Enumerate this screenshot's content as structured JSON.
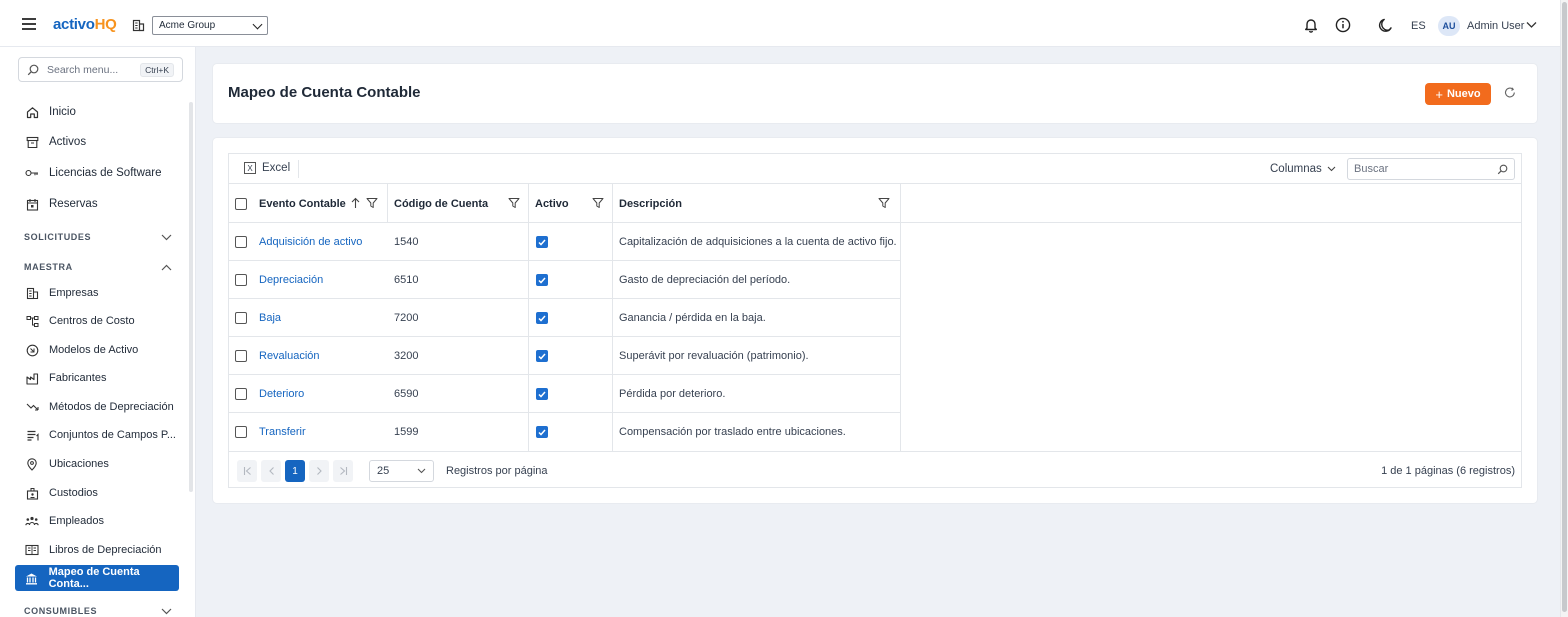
{
  "app": {
    "logo_part1": "activo",
    "logo_part2": "HQ",
    "organization": "Acme Group",
    "language": "ES",
    "user_initials": "AU",
    "user_name": "Admin User",
    "accent_color": "#1565c0",
    "brand_orange": "#f26b1d"
  },
  "sidebar": {
    "search_placeholder": "Search menu...",
    "search_shortcut": "Ctrl+K",
    "items": [
      {
        "label": "Inicio",
        "icon": "home-icon"
      },
      {
        "label": "Activos",
        "icon": "archive-icon"
      },
      {
        "label": "Licencias de Software",
        "icon": "key-icon"
      },
      {
        "label": "Reservas",
        "icon": "calendar-icon"
      }
    ],
    "sections": [
      {
        "label": "SOLICITUDES",
        "expanded": false
      },
      {
        "label": "MAESTRA",
        "expanded": true
      },
      {
        "label": "CONSUMIBLES",
        "expanded": false
      }
    ],
    "maestra_items": [
      {
        "label": "Empresas",
        "icon": "building-icon"
      },
      {
        "label": "Centros de Costo",
        "icon": "org-chart-icon"
      },
      {
        "label": "Modelos de Activo",
        "icon": "model-icon"
      },
      {
        "label": "Fabricantes",
        "icon": "factory-icon"
      },
      {
        "label": "Métodos de Depreciación",
        "icon": "trending-down-icon"
      },
      {
        "label": "Conjuntos de Campos P...",
        "icon": "fields-icon"
      },
      {
        "label": "Ubicaciones",
        "icon": "map-pin-icon"
      },
      {
        "label": "Custodios",
        "icon": "badge-icon"
      },
      {
        "label": "Empleados",
        "icon": "users-icon"
      },
      {
        "label": "Libros de Depreciación",
        "icon": "book-icon"
      },
      {
        "label": "Mapeo de Cuenta Conta...",
        "icon": "bank-icon",
        "active": true
      }
    ]
  },
  "header": {
    "title": "Mapeo de Cuenta Contable",
    "new_button": "Nuevo"
  },
  "table": {
    "excel_label": "Excel",
    "columns_label": "Columnas",
    "search_placeholder": "Buscar",
    "headers": [
      "Evento Contable",
      "Código de Cuenta",
      "Activo",
      "Descripción"
    ],
    "rows": [
      {
        "event": "Adquisición de activo",
        "code": "1540",
        "active": true,
        "description": "Capitalización de adquisiciones a la cuenta de activo fijo."
      },
      {
        "event": "Depreciación",
        "code": "6510",
        "active": true,
        "description": "Gasto de depreciación del período."
      },
      {
        "event": "Baja",
        "code": "7200",
        "active": true,
        "description": "Ganancia / pérdida en la baja."
      },
      {
        "event": "Revaluación",
        "code": "3200",
        "active": true,
        "description": "Superávit por revaluación (patrimonio)."
      },
      {
        "event": "Deterioro",
        "code": "6590",
        "active": true,
        "description": "Pérdida por deterioro."
      },
      {
        "event": "Transferir",
        "code": "1599",
        "active": true,
        "description": "Compensación por traslado entre ubicaciones."
      }
    ]
  },
  "pagination": {
    "current_page": "1",
    "page_size": "25",
    "page_size_label": "Registros por página",
    "info": "1 de 1 páginas (6 registros)"
  }
}
